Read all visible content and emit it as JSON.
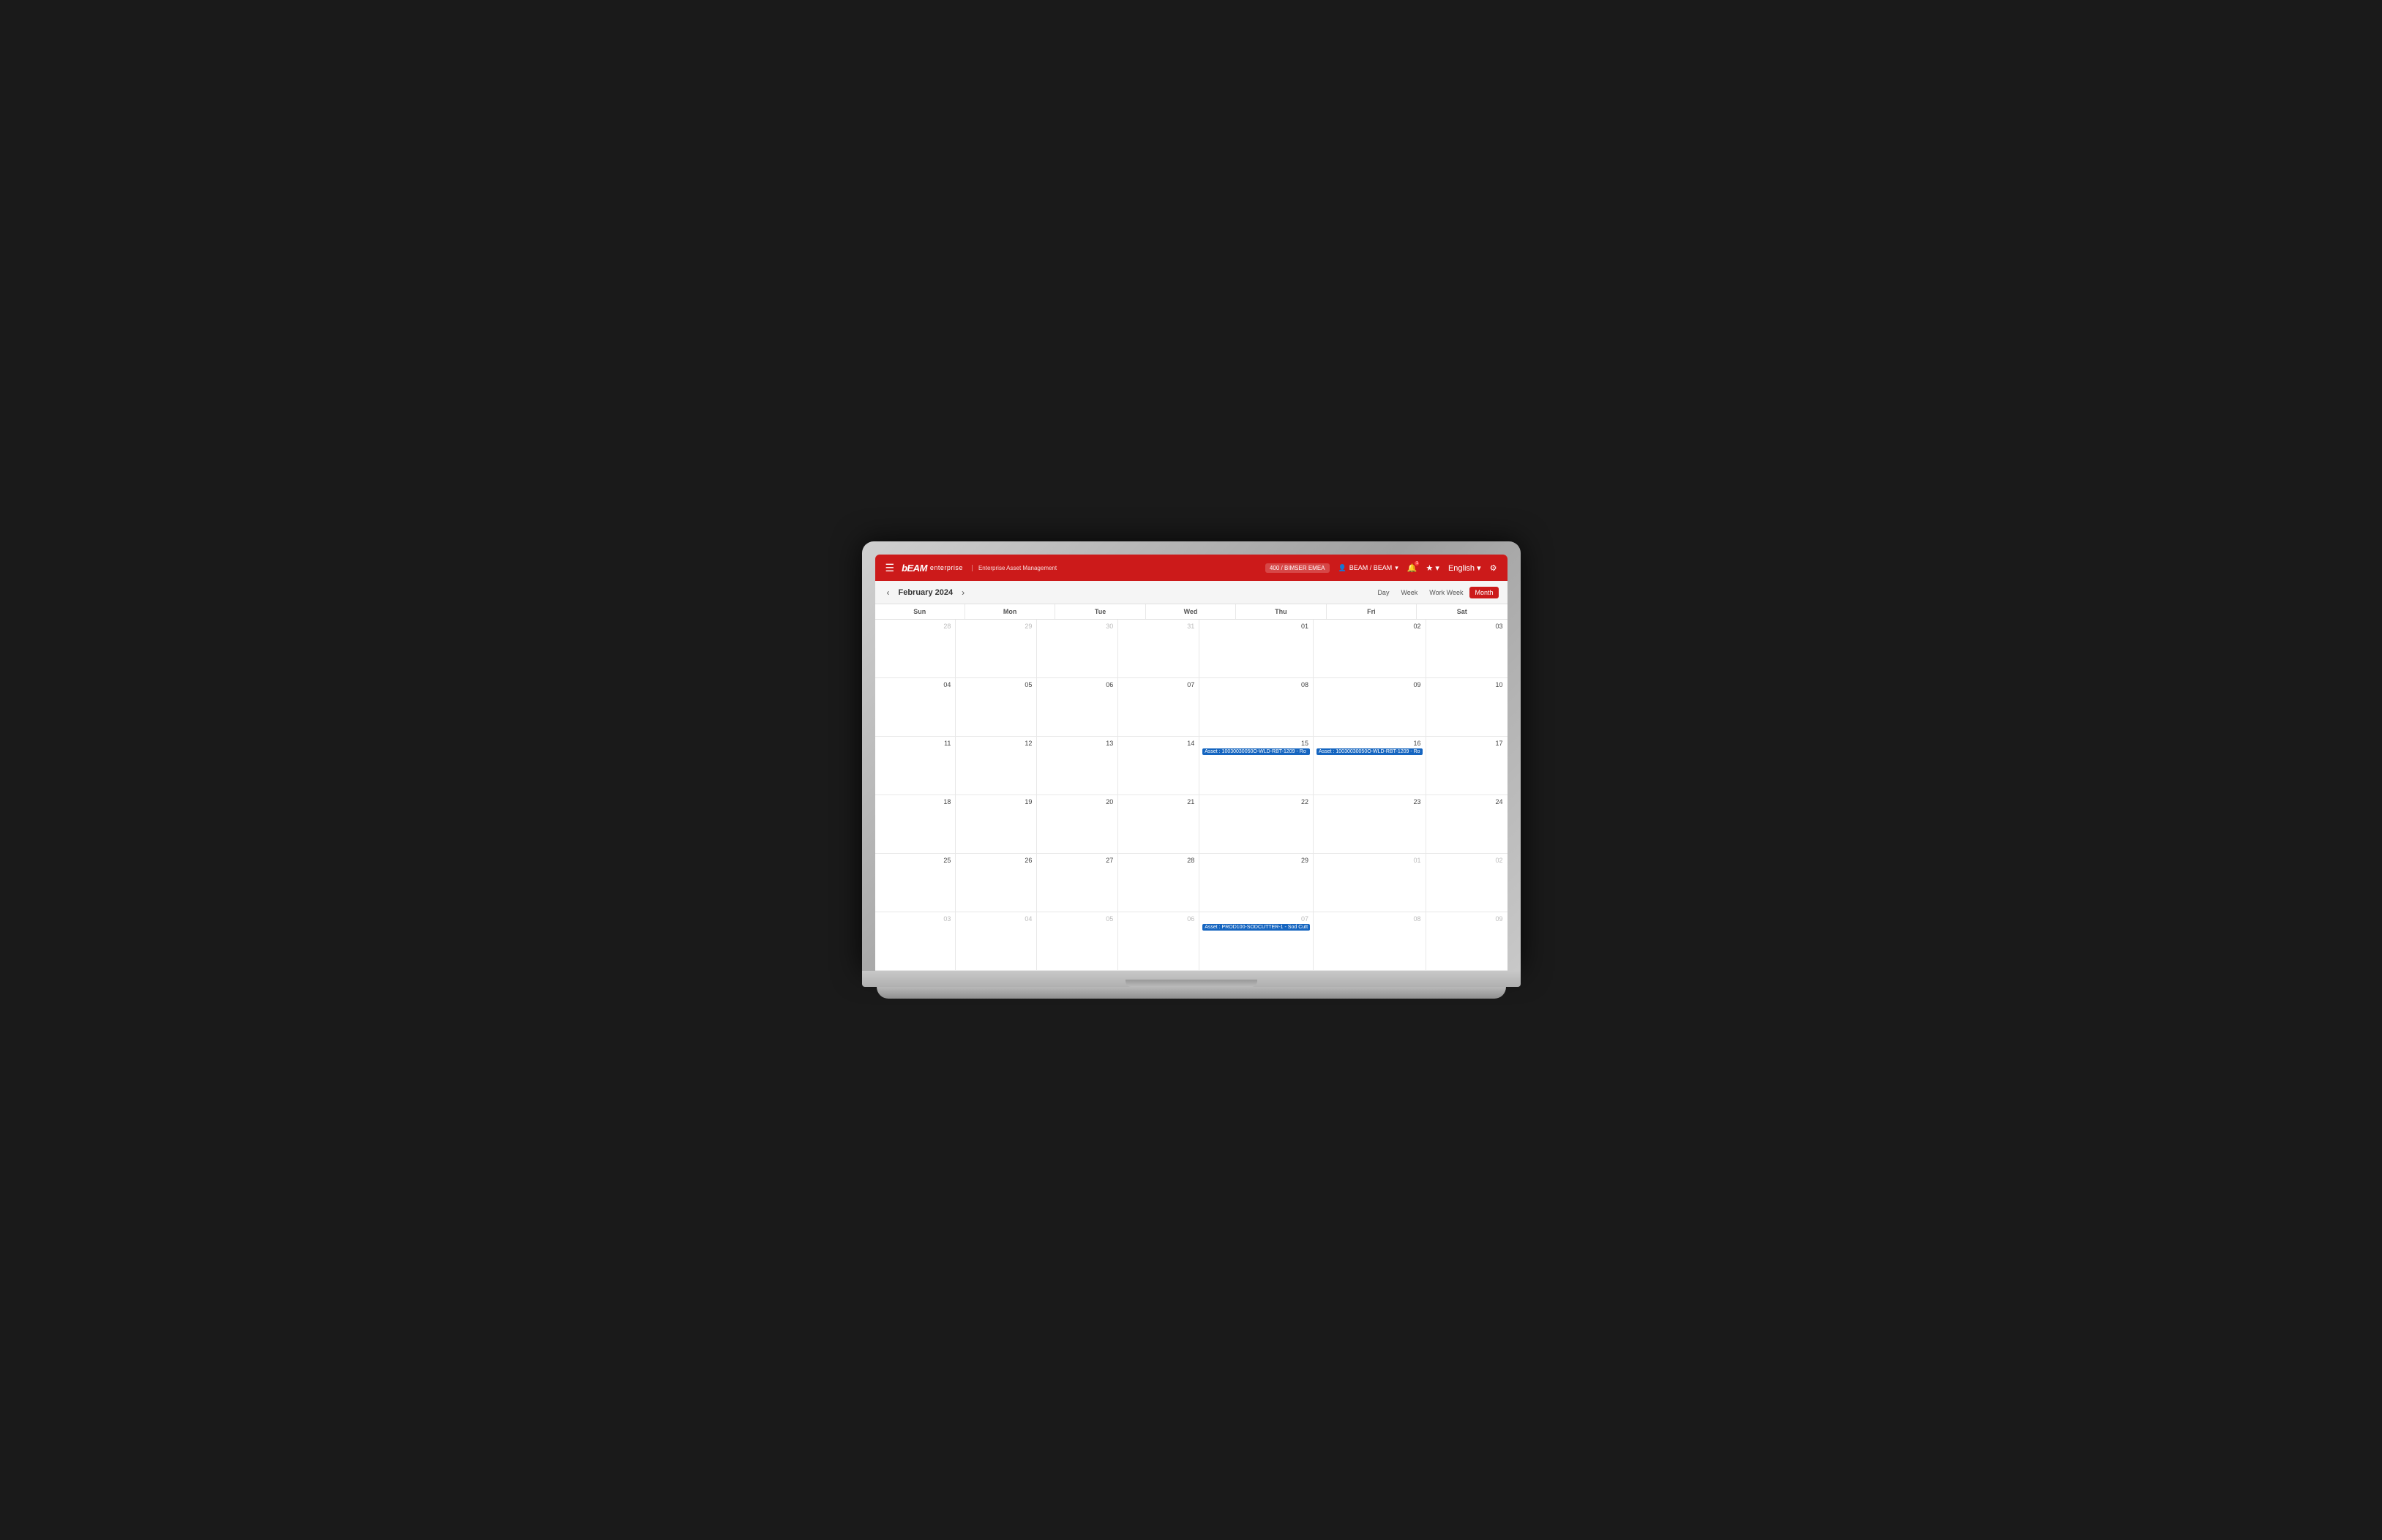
{
  "app": {
    "title": "BEAM enterprise",
    "subtitle": "Enterprise Asset Management",
    "logo_text": "BEAM",
    "logo_suffix": "enterprise"
  },
  "header": {
    "badge": "400 / BIMSER EMEA",
    "user": "BEAM / BEAM",
    "language": "English",
    "hamburger": "☰",
    "bell_icon": "🔔",
    "star_icon": "★",
    "user_icon": "👤",
    "settings_icon": "⚙"
  },
  "toolbar": {
    "month_year": "February 2024",
    "prev_label": "‹",
    "next_label": "›",
    "views": [
      "Day",
      "Week",
      "Work Week",
      "Month"
    ],
    "active_view": "Month"
  },
  "calendar": {
    "day_headers": [
      "Sun",
      "Mon",
      "Tue",
      "Wed",
      "Thu",
      "Fri",
      "Sat"
    ],
    "weeks": [
      [
        {
          "day": "28",
          "other": true,
          "events": []
        },
        {
          "day": "29",
          "other": true,
          "events": []
        },
        {
          "day": "30",
          "other": true,
          "events": []
        },
        {
          "day": "31",
          "other": true,
          "events": []
        },
        {
          "day": "01",
          "other": false,
          "events": []
        },
        {
          "day": "02",
          "other": false,
          "events": []
        },
        {
          "day": "03",
          "other": false,
          "events": []
        }
      ],
      [
        {
          "day": "04",
          "other": false,
          "events": []
        },
        {
          "day": "05",
          "other": false,
          "events": []
        },
        {
          "day": "06",
          "other": false,
          "events": []
        },
        {
          "day": "07",
          "other": false,
          "events": []
        },
        {
          "day": "08",
          "other": false,
          "events": []
        },
        {
          "day": "09",
          "other": false,
          "events": []
        },
        {
          "day": "10",
          "other": false,
          "events": []
        }
      ],
      [
        {
          "day": "11",
          "other": false,
          "events": []
        },
        {
          "day": "12",
          "other": false,
          "events": []
        },
        {
          "day": "13",
          "other": false,
          "events": []
        },
        {
          "day": "14",
          "other": false,
          "events": []
        },
        {
          "day": "15",
          "other": false,
          "events": [
            "Asset : 10030030050O-WLD-RBT-1209 - Ro"
          ]
        },
        {
          "day": "16",
          "other": false,
          "events": [
            "Asset : 10030030050O-WLD-RBT-1209 - Ro"
          ]
        },
        {
          "day": "17",
          "other": false,
          "events": []
        }
      ],
      [
        {
          "day": "18",
          "other": false,
          "events": []
        },
        {
          "day": "19",
          "other": false,
          "events": []
        },
        {
          "day": "20",
          "other": false,
          "events": []
        },
        {
          "day": "21",
          "other": false,
          "events": []
        },
        {
          "day": "22",
          "other": false,
          "events": []
        },
        {
          "day": "23",
          "other": false,
          "events": []
        },
        {
          "day": "24",
          "other": false,
          "events": []
        }
      ],
      [
        {
          "day": "25",
          "other": false,
          "events": []
        },
        {
          "day": "26",
          "other": false,
          "events": []
        },
        {
          "day": "27",
          "other": false,
          "events": []
        },
        {
          "day": "28",
          "other": false,
          "events": []
        },
        {
          "day": "29",
          "other": false,
          "events": []
        },
        {
          "day": "01",
          "other": true,
          "events": []
        },
        {
          "day": "02",
          "other": true,
          "events": []
        }
      ],
      [
        {
          "day": "03",
          "other": true,
          "events": []
        },
        {
          "day": "04",
          "other": true,
          "events": []
        },
        {
          "day": "05",
          "other": true,
          "events": []
        },
        {
          "day": "06",
          "other": true,
          "events": []
        },
        {
          "day": "07",
          "other": true,
          "events": [
            "Asset : PROD100-SODCUTTER-1 - Sod Cutt"
          ]
        },
        {
          "day": "08",
          "other": true,
          "events": []
        },
        {
          "day": "09",
          "other": true,
          "events": []
        }
      ]
    ]
  }
}
